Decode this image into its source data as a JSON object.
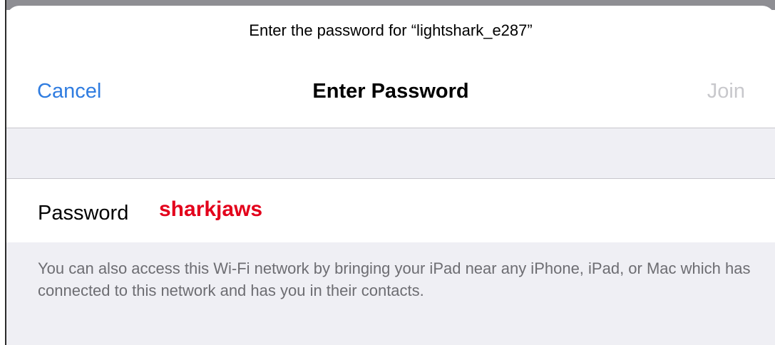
{
  "prompt": "Enter the password for “lightshark_e287”",
  "navbar": {
    "cancel_label": "Cancel",
    "title": "Enter Password",
    "join_label": "Join"
  },
  "password_field": {
    "label": "Password",
    "value": "sharkjaws"
  },
  "footer": {
    "text": "You can also access this Wi-Fi network by bringing your iPad near any iPhone, iPad, or Mac which has connected to this network and has you in their contacts."
  },
  "colors": {
    "accent": "#2f7ce0",
    "disabled": "#c8c8cc",
    "password_text": "#e3001b",
    "group_background": "#efeff4"
  }
}
